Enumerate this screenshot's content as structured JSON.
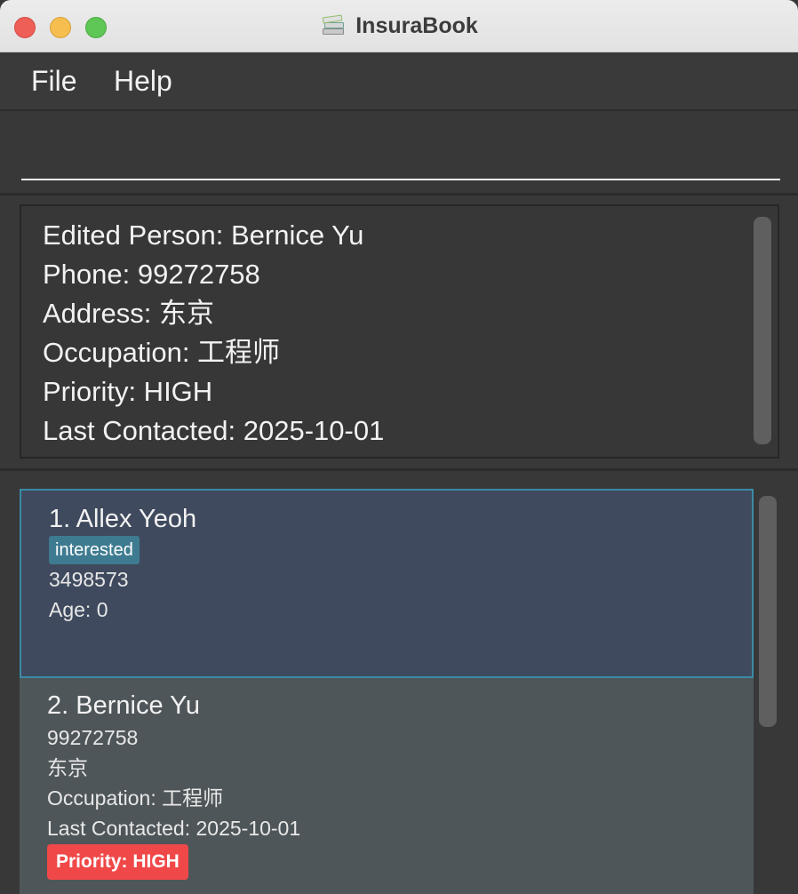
{
  "window": {
    "title": "InsuraBook",
    "app_icon": "books-icon"
  },
  "menu": {
    "items": [
      {
        "label": "File"
      },
      {
        "label": "Help"
      }
    ]
  },
  "command": {
    "value": "",
    "placeholder": ""
  },
  "result": {
    "lines": [
      "Edited Person: Bernice Yu",
      "Phone: 99272758",
      "Address: 东京",
      "Occupation: 工程师",
      "Priority: HIGH",
      "Last Contacted: 2025-10-01"
    ]
  },
  "persons": [
    {
      "name": "1. Allex Yeoh",
      "tag": "interested",
      "phone": "3498573",
      "age": "Age: 0",
      "selected": true
    },
    {
      "name": "2. Bernice Yu",
      "phone": "99272758",
      "address": "东京",
      "occupation": "Occupation: 工程师",
      "last_contacted": "Last Contacted: 2025-10-01",
      "priority": "Priority: HIGH",
      "selected": false
    }
  ],
  "colors": {
    "selected_card": "#3f4a5e",
    "selected_border": "#3b8aa5",
    "card": "#4f5659",
    "tag": "#3e7b91",
    "priority_high": "#f04848",
    "background": "#383838"
  }
}
